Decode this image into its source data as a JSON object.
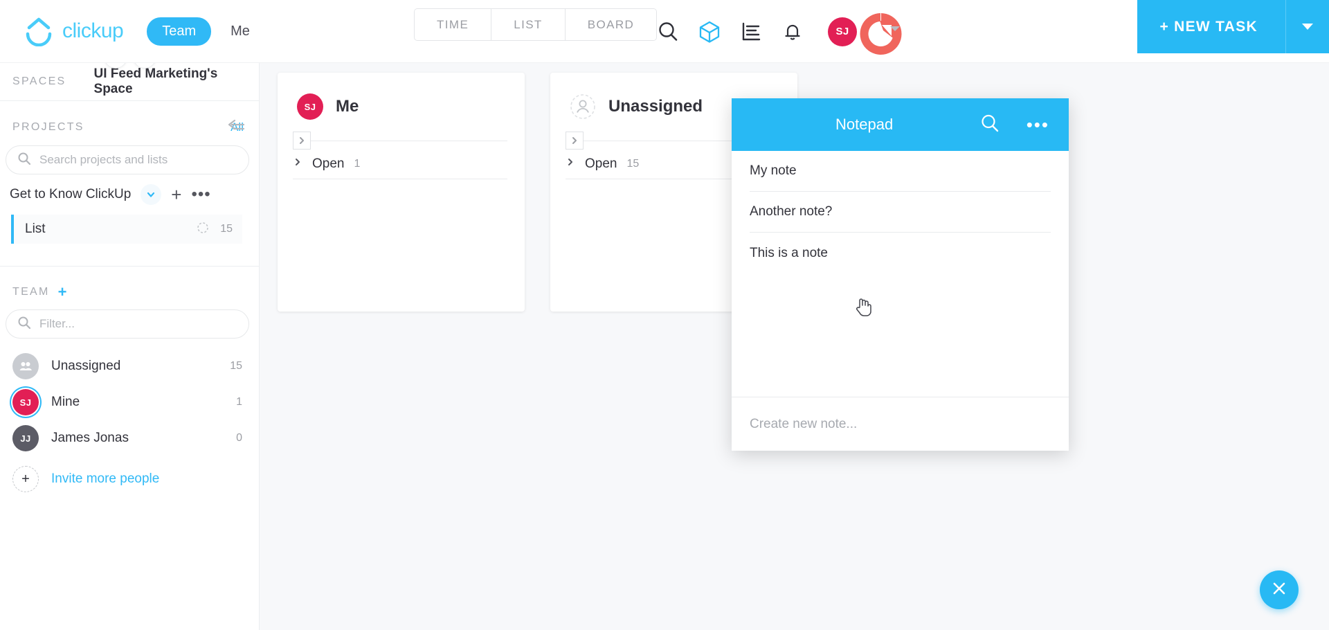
{
  "colors": {
    "brand_blue": "#28b9f4",
    "logo_blue": "#49ccf9",
    "avatar_pink": "#e21f55",
    "coral": "#f0655c",
    "text_dark": "#33333b",
    "text_muted": "#9b9da3"
  },
  "topbar": {
    "logo_text": "clickup",
    "logo_icon": "clickup-logo-icon",
    "toggle": [
      {
        "label": "Team",
        "active": true
      },
      {
        "label": "Me",
        "active": false
      }
    ],
    "view_tabs": [
      {
        "label": "TIME",
        "active": false
      },
      {
        "label": "LIST",
        "active": false
      },
      {
        "label": "BOARD",
        "active": true
      }
    ],
    "icons": [
      {
        "name": "search-icon"
      },
      {
        "name": "cube-icon"
      },
      {
        "name": "bar-chart-icon"
      },
      {
        "name": "bell-icon"
      },
      {
        "name": "more-vertical-icon"
      }
    ],
    "avatar_initials": "SJ",
    "new_task_label": "+ NEW TASK"
  },
  "sidebar": {
    "badges": [
      {
        "name": "star-icon",
        "glyph": "★"
      },
      {
        "name": "lightning-icon",
        "glyph": "⚡"
      }
    ],
    "spaces_label": "SPACES",
    "space_name": "UI Feed Marketing's Space",
    "projects_label": "PROJECTS",
    "all_label": "All",
    "search_placeholder": "Search projects and lists",
    "search_value": "",
    "project": {
      "name": "Get to Know ClickUp",
      "lists": [
        {
          "name": "List",
          "count": "15"
        }
      ]
    },
    "team_label": "TEAM",
    "filter_placeholder": "Filter...",
    "filter_value": "",
    "members": [
      {
        "name": "Unassigned",
        "count": "15",
        "initials": "",
        "avatar": "group-icon",
        "color": "#c9ccd1",
        "selected": false
      },
      {
        "name": "Mine",
        "count": "1",
        "initials": "SJ",
        "avatar": "avatar",
        "color": "#e21f55",
        "selected": true
      },
      {
        "name": "James Jonas",
        "count": "0",
        "initials": "JJ",
        "avatar": "avatar",
        "color": "#5c5c66",
        "selected": false
      }
    ],
    "invite_label": "Invite more people"
  },
  "board": {
    "columns": [
      {
        "title": "Me",
        "avatar_initials": "SJ",
        "avatar_color": "#e21f55",
        "avatar_type": "avatar",
        "group_name": "Open",
        "group_count": "1"
      },
      {
        "title": "Unassigned",
        "avatar_initials": "",
        "avatar_color": "#ffffff",
        "avatar_type": "person-outline-icon",
        "group_name": "Open",
        "group_count": "15"
      }
    ]
  },
  "notepad": {
    "title": "Notepad",
    "search_icon": "search-icon",
    "more_icon": "more-horizontal-icon",
    "notes": [
      {
        "text": "My note"
      },
      {
        "text": "Another note?"
      },
      {
        "text": "This is a note"
      }
    ],
    "create_placeholder": "Create new note...",
    "create_value": ""
  },
  "fab": {
    "icon": "close-icon"
  }
}
